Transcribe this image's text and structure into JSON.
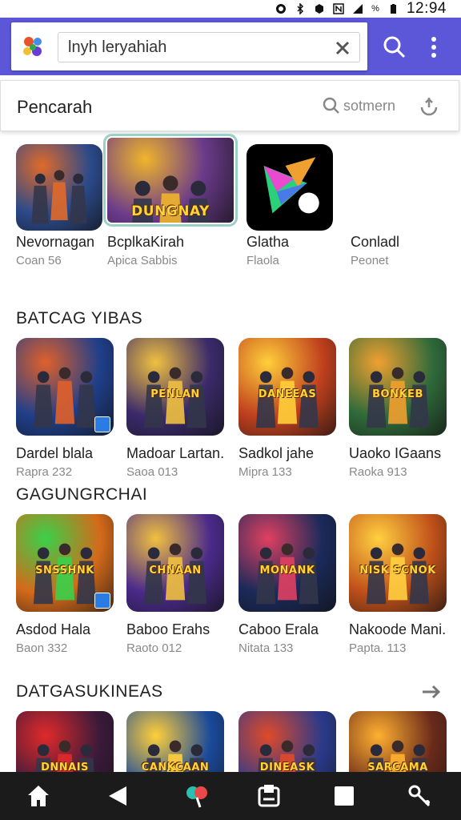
{
  "status_bar": {
    "time": "12:94",
    "battery_label": "%"
  },
  "search": {
    "query": "lnyh leryahiah"
  },
  "search_row": {
    "title": "Pencarah",
    "action_label": "sotmern"
  },
  "featured": [
    {
      "name": "Nevornagan",
      "sub": "Coan 56",
      "bg": "#2b4a8a",
      "accent": "#e06a2a"
    },
    {
      "name": "BcplkaKirah",
      "sub": "Apica Sabbis",
      "bg": "#6a3a8a",
      "accent": "#f0b52a",
      "art_text": "DUNGNAY"
    },
    {
      "name": "Glatha",
      "sub": "Flaola",
      "bg": "#000000",
      "accent": "#6a2ad8"
    },
    {
      "name": "Conladl",
      "sub": "Peonet"
    }
  ],
  "sections": [
    {
      "title": "BATCAG YIBAS",
      "apps": [
        {
          "name": "Dardel blala",
          "sub": "Rapra 232",
          "bg": "#1f3f8a",
          "accent": "#e0602a"
        },
        {
          "name": "Madoar Lartan.",
          "sub": "Saoa 013",
          "bg": "#3a2a6a",
          "accent": "#f0c040",
          "art_text": "PENLAN"
        },
        {
          "name": "Sadkol jahe",
          "sub": "Mipra 133",
          "bg": "#c0401e",
          "accent": "#ffcf3a",
          "art_text": "DANEEAS"
        },
        {
          "name": "Uaoko IGaans",
          "sub": "Raoka 913",
          "bg": "#2f6a3a",
          "accent": "#f0a030",
          "art_text": "BONKEB"
        }
      ]
    },
    {
      "title": "GAGUNGRCHAI",
      "apps": [
        {
          "name": "Asdod Hala",
          "sub": "Baon 332",
          "bg": "#d46a1a",
          "accent": "#3ad04a",
          "art_text": "SNSSHNK"
        },
        {
          "name": "Baboo Erahs",
          "sub": "Raoto 012",
          "bg": "#4a2a8a",
          "accent": "#f0c040",
          "art_text": "CHNAAN"
        },
        {
          "name": "Caboo Erala",
          "sub": "Nitata 133",
          "bg": "#1a2a5a",
          "accent": "#e04060",
          "art_text": "MONANK"
        },
        {
          "name": "Nakoode Mani.",
          "sub": "Papta. 113",
          "bg": "#c0501a",
          "accent": "#ffd040",
          "art_text": "NISK SCNOK"
        }
      ]
    },
    {
      "title": "DATGASUKINEAS",
      "apps": [
        {
          "bg": "#3a1a3a",
          "accent": "#e02a2a",
          "art_text": "DNNAIS"
        },
        {
          "bg": "#1a4a9a",
          "accent": "#ffcf3a",
          "art_text": "CANKCAAN"
        },
        {
          "bg": "#2a3a8a",
          "accent": "#e04a2a",
          "art_text": "DINEASK"
        },
        {
          "bg": "#6a2a1a",
          "accent": "#ffb030",
          "art_text": "SARCAMA"
        }
      ]
    }
  ],
  "nav": [
    "home",
    "back",
    "discover",
    "library",
    "recents",
    "tools"
  ],
  "colors": {
    "app_bar": "#5b57d8",
    "nav_bar": "#1b1b1b",
    "section_title": "#222222"
  }
}
